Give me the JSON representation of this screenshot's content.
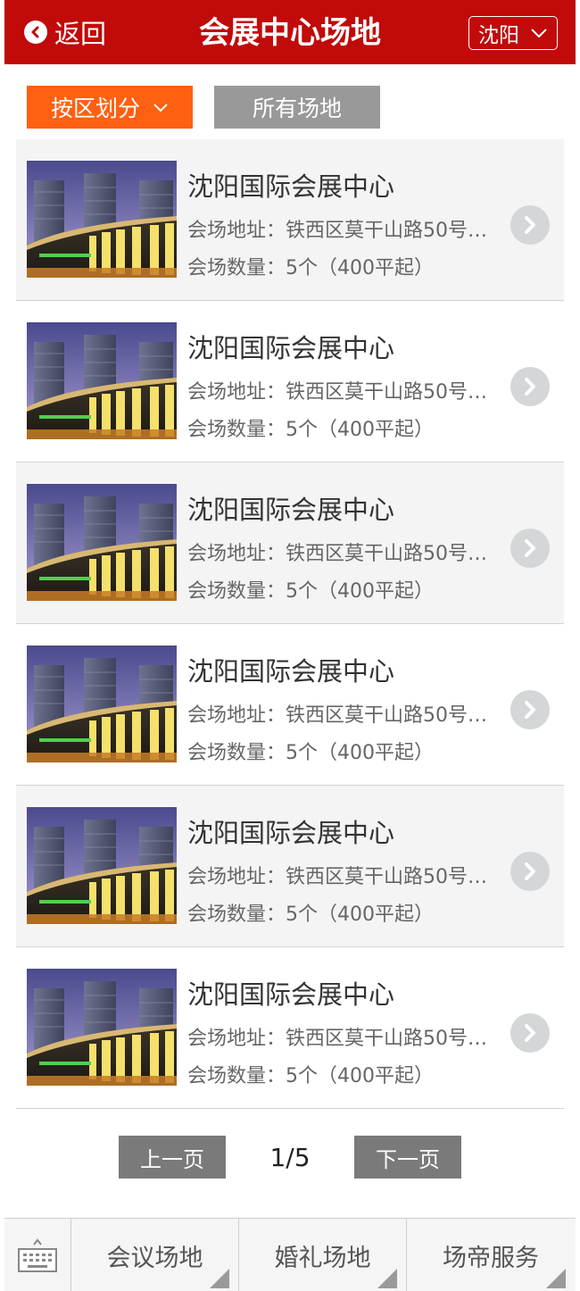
{
  "header": {
    "back_label": "返回",
    "title": "会展中心场地",
    "city": "沈阳"
  },
  "filters": {
    "district_label": "按区划分",
    "all_label": "所有场地"
  },
  "venues": [
    {
      "name": "沈阳国际会展中心",
      "address": "会场地址：铁西区莫干山路50号…",
      "count": "会场数量：5个（400平起）"
    },
    {
      "name": "沈阳国际会展中心",
      "address": "会场地址：铁西区莫干山路50号…",
      "count": "会场数量：5个（400平起）"
    },
    {
      "name": "沈阳国际会展中心",
      "address": "会场地址：铁西区莫干山路50号…",
      "count": "会场数量：5个（400平起）"
    },
    {
      "name": "沈阳国际会展中心",
      "address": "会场地址：铁西区莫干山路50号…",
      "count": "会场数量：5个（400平起）"
    },
    {
      "name": "沈阳国际会展中心",
      "address": "会场地址：铁西区莫干山路50号…",
      "count": "会场数量：5个（400平起）"
    },
    {
      "name": "沈阳国际会展中心",
      "address": "会场地址：铁西区莫干山路50号…",
      "count": "会场数量：5个（400平起）"
    }
  ],
  "pagination": {
    "prev_label": "上一页",
    "page": "1/5",
    "next_label": "下一页"
  },
  "bottom_nav": {
    "keyboard_icon": "keyboard-icon",
    "tabs": [
      {
        "label": "会议场地"
      },
      {
        "label": "婚礼场地"
      },
      {
        "label": "场帝服务"
      }
    ]
  },
  "colors": {
    "header_bg": "#c10a0a",
    "district_filter_bg": "#ff6012",
    "all_filter_bg": "#999999",
    "pager_bg": "#7a7a7a"
  }
}
